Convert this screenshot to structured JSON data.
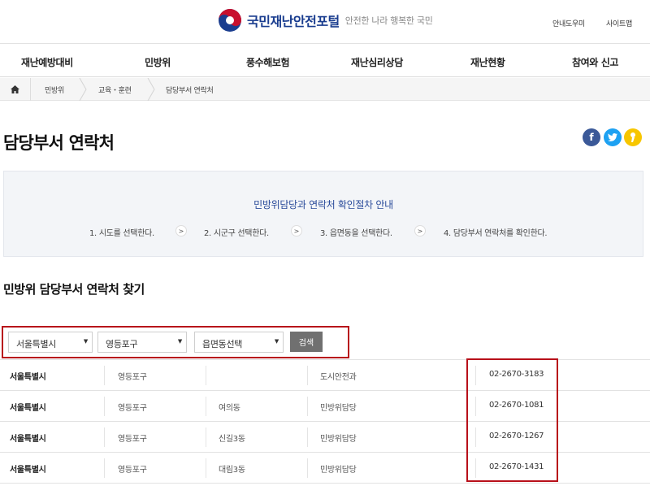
{
  "header": {
    "site_title": "국민재난안전포털",
    "slogan": "안전한 나라 행복한 국민",
    "util_help": "안내도우미",
    "util_sitemap": "사이트맵"
  },
  "gnb": {
    "items": [
      "재난예방대비",
      "민방위",
      "풍수해보험",
      "재난심리상담",
      "재난현황",
      "참여와 신고"
    ]
  },
  "breadcrumb": {
    "items": [
      "민방위",
      "교육・훈련",
      "담당부서 연락처"
    ]
  },
  "page_title": "담당부서 연락처",
  "share": {
    "facebook": "f",
    "twitter": "t",
    "kakao": "k"
  },
  "info": {
    "title": "민방위담당과 연락처 확인절차 안내",
    "steps": [
      "1. 시도를 선택한다.",
      "2. 시군구 선택한다.",
      "3. 읍면동을 선택한다.",
      "4. 담당부서 연락처를 확인한다."
    ]
  },
  "section_title": "민방위 담당부서 연락처 찾기",
  "search": {
    "sido": "서울특별시",
    "sigungu": "영등포구",
    "eupmyeondong": "읍면동선택",
    "button": "검색"
  },
  "table": {
    "rows": [
      {
        "city": "서울특별시",
        "gu": "영등포구",
        "dong": "",
        "dept": "도시안전과",
        "phone": "02-2670-3183"
      },
      {
        "city": "서울특별시",
        "gu": "영등포구",
        "dong": "여의동",
        "dept": "민방위담당",
        "phone": "02-2670-1081"
      },
      {
        "city": "서울특별시",
        "gu": "영등포구",
        "dong": "신길3동",
        "dept": "민방위담당",
        "phone": "02-2670-1267"
      },
      {
        "city": "서울특별시",
        "gu": "영등포구",
        "dong": "대림3동",
        "dept": "민방위담당",
        "phone": "02-2670-1431"
      }
    ]
  },
  "colors": {
    "brand": "#1a3d8f",
    "highlight": "#b8101a",
    "facebook": "#3b5998",
    "twitter": "#1da1f2",
    "kakao": "#f7c600"
  }
}
